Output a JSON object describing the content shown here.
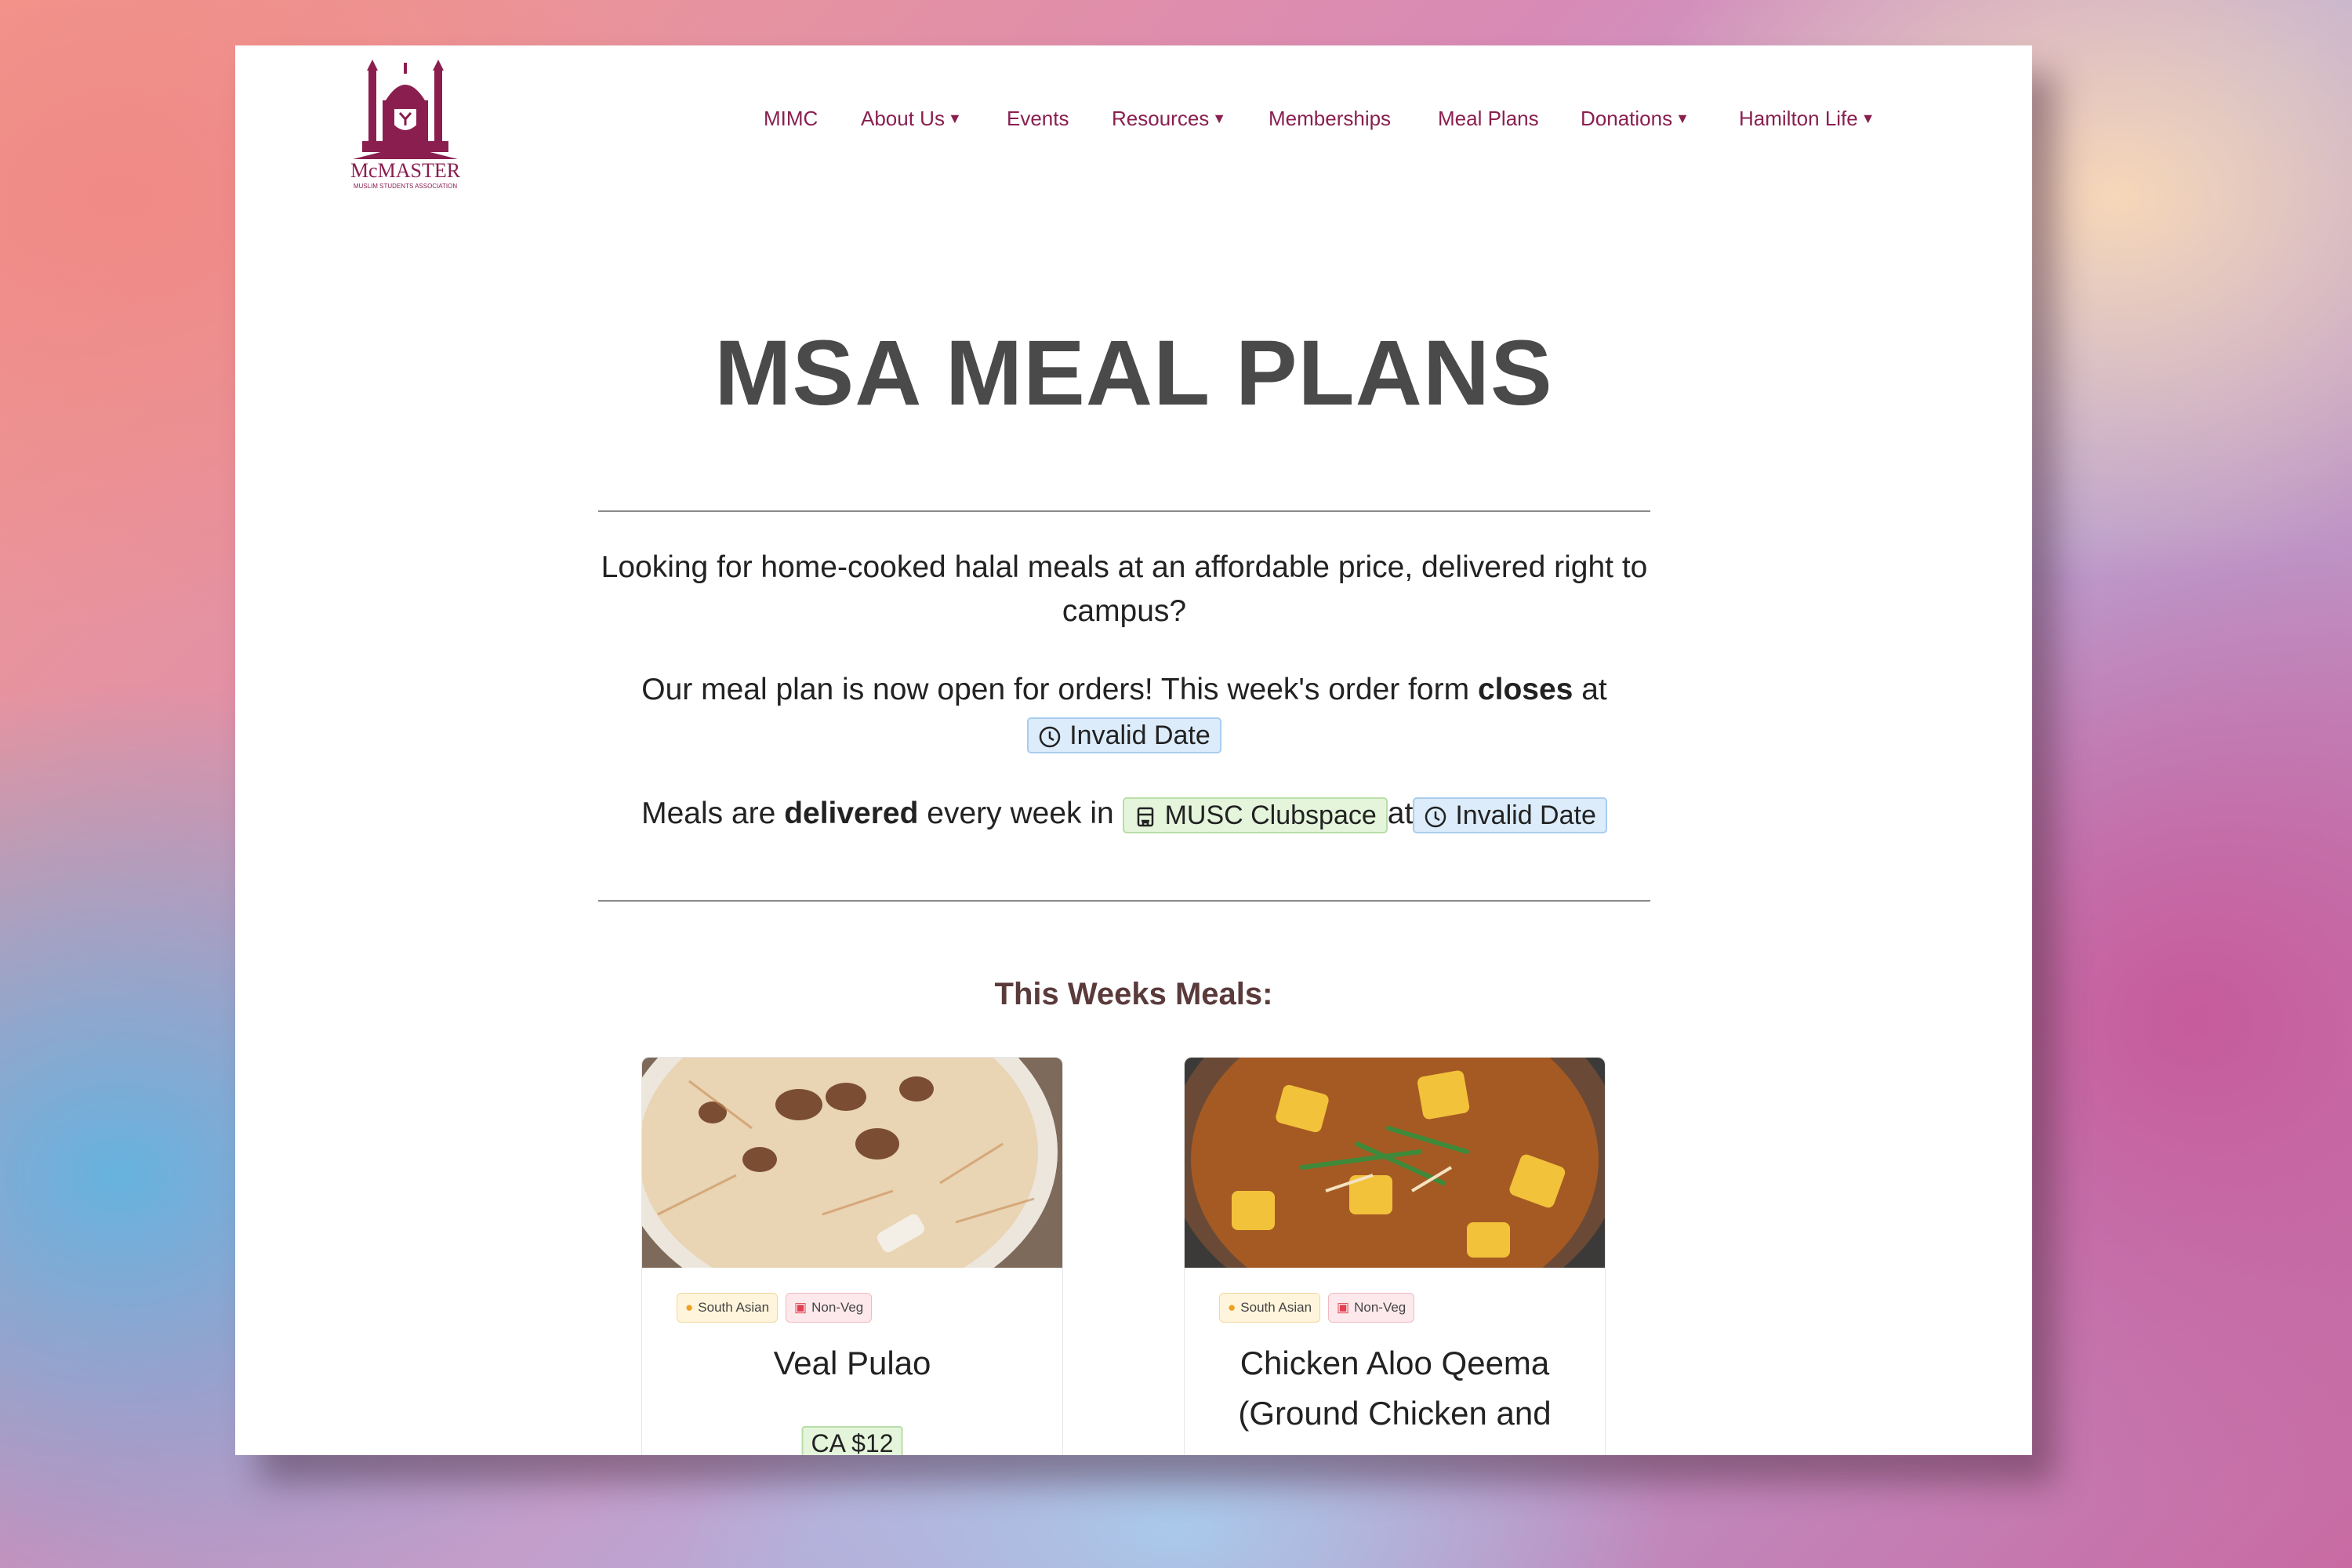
{
  "nav": {
    "items": [
      {
        "label": "MIMC"
      },
      {
        "label": "About Us",
        "caret": "▾"
      },
      {
        "label": "Events"
      },
      {
        "label": "Resources",
        "caret": "▾"
      },
      {
        "label": "Memberships"
      },
      {
        "label": "Meal Plans"
      },
      {
        "label": "Donations",
        "caret": "▾"
      },
      {
        "label": "Hamilton Life",
        "caret": "▾"
      }
    ]
  },
  "logo": {
    "line1": "McMASTER",
    "line2": "MUSLIM STUDENTS ASSOCIATION"
  },
  "hero": {
    "title": "MSA MEAL PLANS"
  },
  "intro": {
    "p1": "Looking for home-cooked halal meals at an affordable price, delivered right to campus?",
    "p2_a": "Our meal plan is now open for orders! This week's order form ",
    "p2_bold": "closes",
    "p2_b": " at",
    "p2_chip": "Invalid Date",
    "p3_a": "Meals are ",
    "p3_bold": "delivered",
    "p3_b": " every week in",
    "p3_location": "MUSC Clubspace",
    "p3_at": "at",
    "p3_time": "Invalid Date"
  },
  "meals_section": {
    "title": "This Weeks Meals:"
  },
  "meals": [
    {
      "tag1": "South Asian",
      "tag2": "Non-Veg",
      "name": "Veal Pulao",
      "price": "CA $12"
    },
    {
      "tag1": "South Asian",
      "tag2": "Non-Veg",
      "name": "Chicken Aloo Qeema (Ground Chicken and"
    }
  ],
  "colors": {
    "brand": "#8a1f4f",
    "title": "#4a4a4a"
  }
}
